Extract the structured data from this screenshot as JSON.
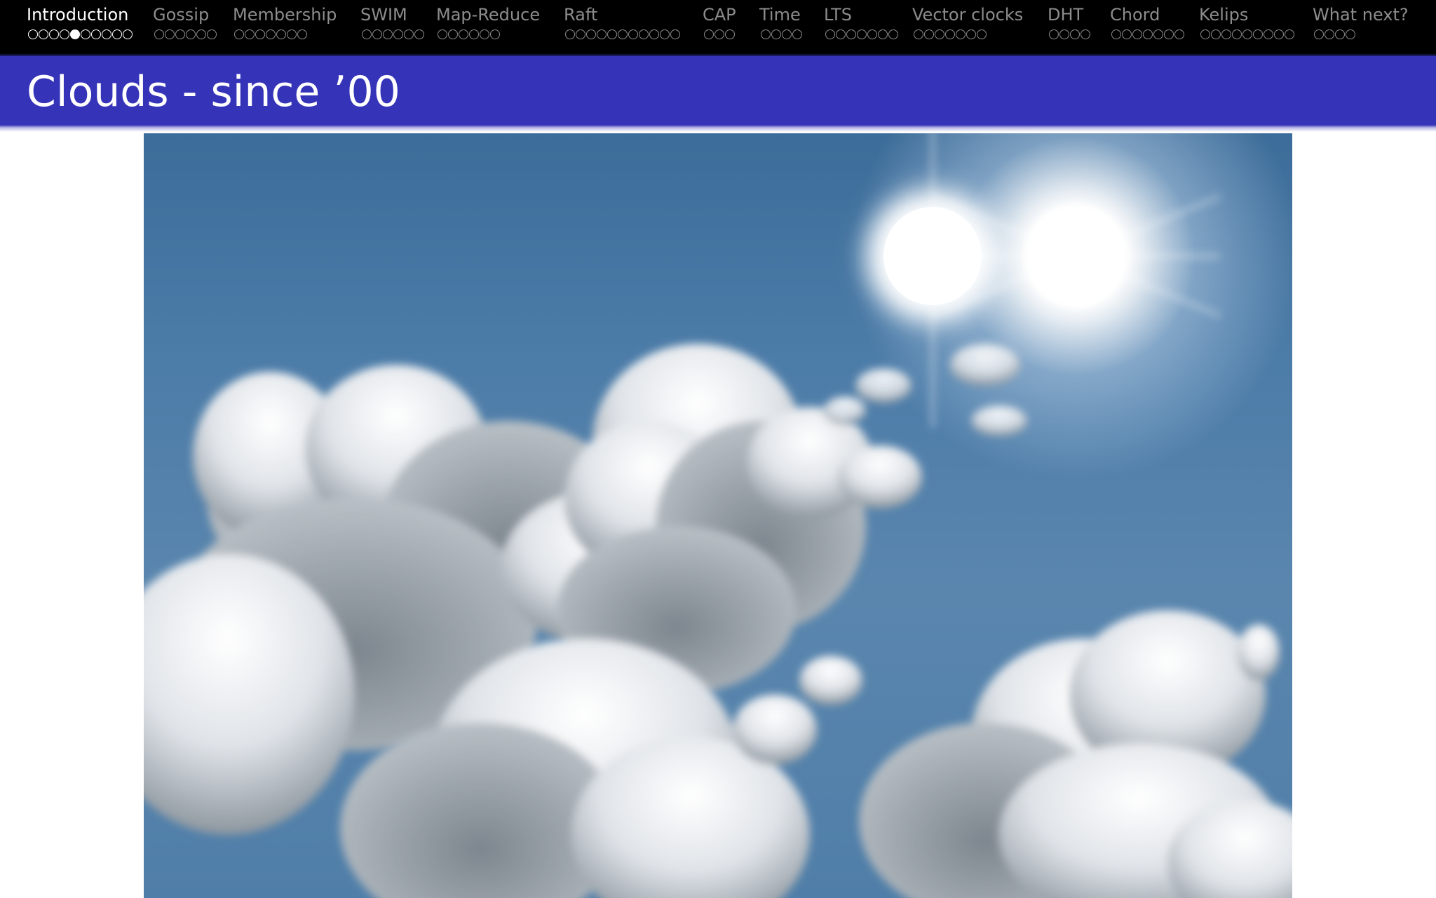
{
  "navigation": {
    "sections": [
      {
        "label": "Introduction",
        "dots": 10,
        "current_dot": 5,
        "active": true
      },
      {
        "label": "Gossip",
        "dots": 6,
        "current_dot": 0,
        "active": false
      },
      {
        "label": "Membership",
        "dots": 7,
        "current_dot": 0,
        "active": false
      },
      {
        "label": "SWIM",
        "dots": 6,
        "current_dot": 0,
        "active": false
      },
      {
        "label": "Map-Reduce",
        "dots": 6,
        "current_dot": 0,
        "active": false
      },
      {
        "label": "Raft",
        "dots": 11,
        "current_dot": 0,
        "active": false
      },
      {
        "label": "CAP",
        "dots": 3,
        "current_dot": 0,
        "active": false
      },
      {
        "label": "Time",
        "dots": 4,
        "current_dot": 0,
        "active": false
      },
      {
        "label": "LTS",
        "dots": 7,
        "current_dot": 0,
        "active": false
      },
      {
        "label": "Vector clocks",
        "dots": 7,
        "current_dot": 0,
        "active": false
      },
      {
        "label": "DHT",
        "dots": 4,
        "current_dot": 0,
        "active": false
      },
      {
        "label": "Chord",
        "dots": 7,
        "current_dot": 0,
        "active": false
      },
      {
        "label": "Kelips",
        "dots": 9,
        "current_dot": 0,
        "active": false
      },
      {
        "label": "What next?",
        "dots": 4,
        "current_dot": 0,
        "active": false
      }
    ]
  },
  "frame": {
    "title": "Clouds - since ’00"
  },
  "image": {
    "subject": "sky-with-sun-and-clouds-photo"
  },
  "colors": {
    "nav_background": "#000000",
    "title_bar": "#3533b8",
    "nav_inactive": "#8c8c8c",
    "nav_active": "#ffffff"
  }
}
